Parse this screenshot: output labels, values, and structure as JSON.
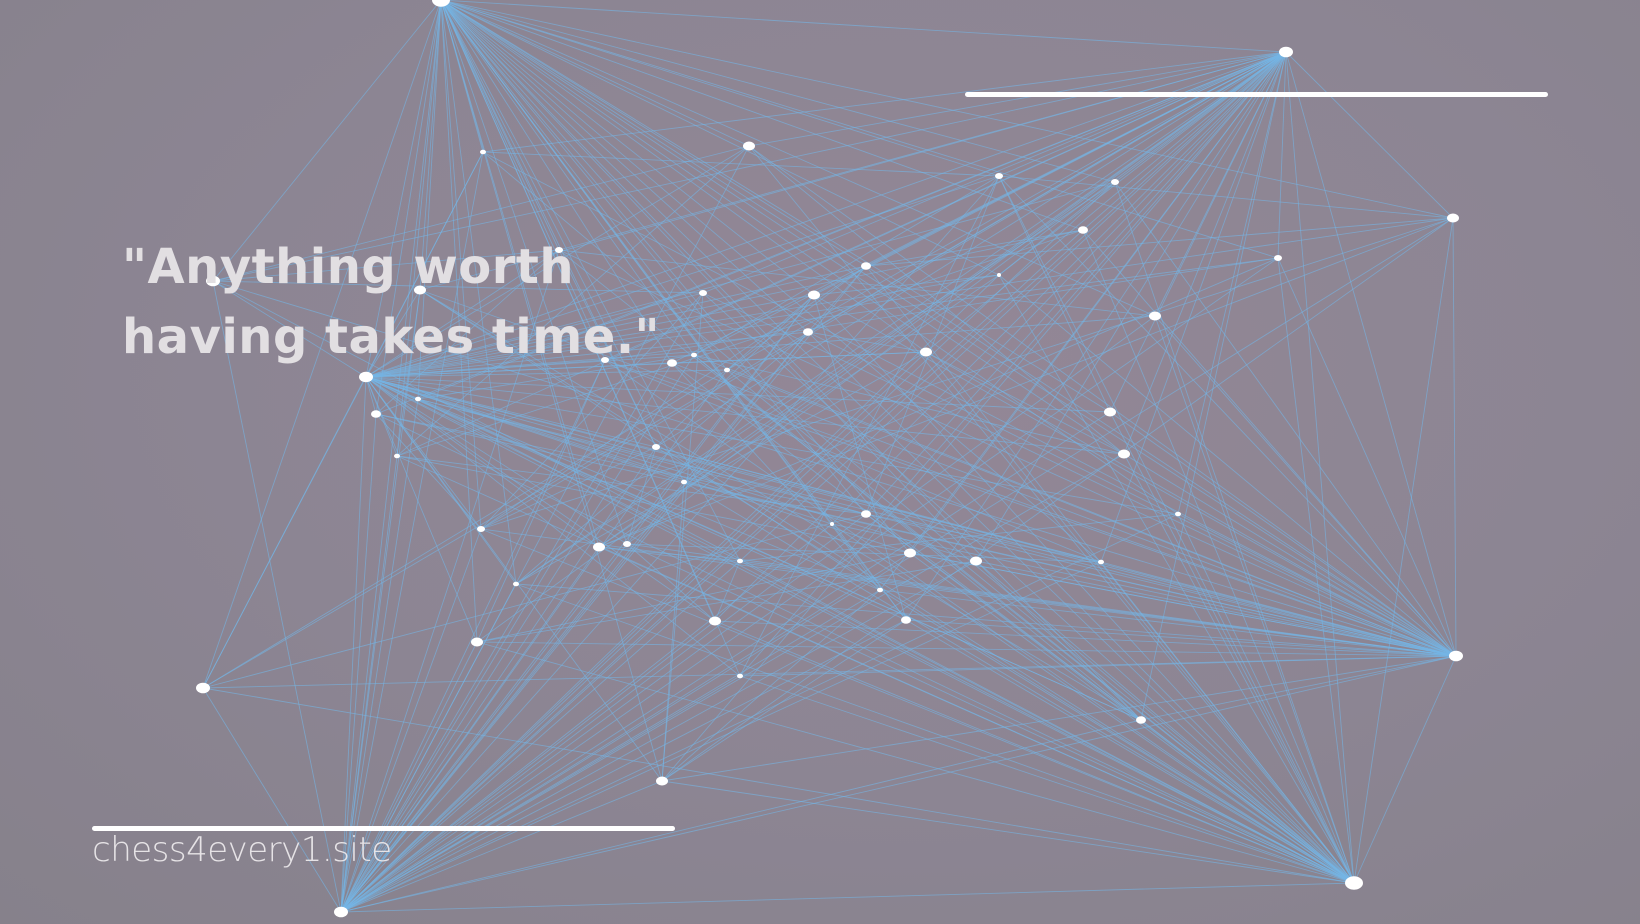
{
  "quote": {
    "line1": "\"Anything worth",
    "line2": "having takes time.\""
  },
  "site": {
    "url": "chess4every1.site"
  },
  "colors": {
    "line": "#74b6e6",
    "node": "#ffffff",
    "text": "#e2dfe2"
  }
}
